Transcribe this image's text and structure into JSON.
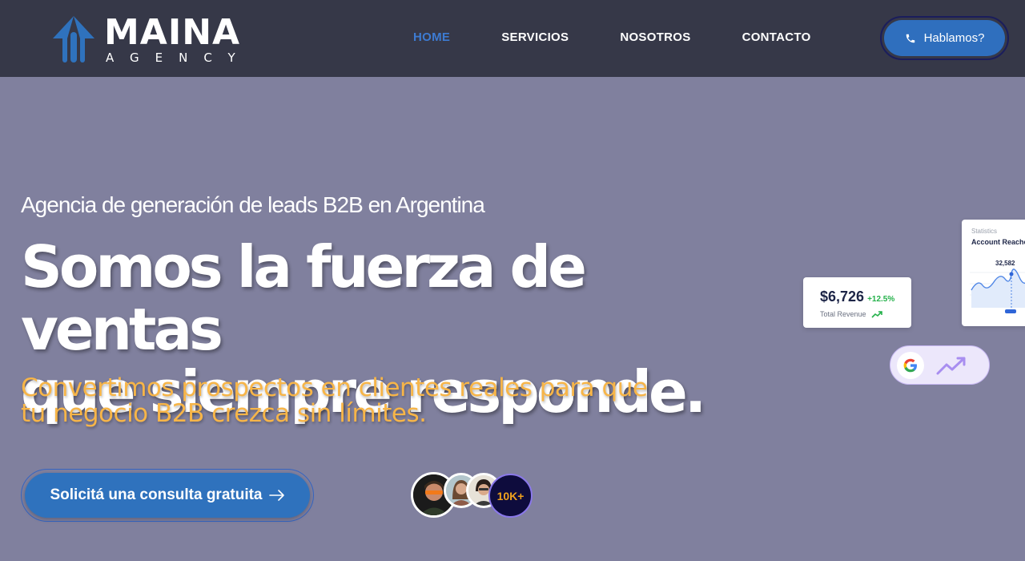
{
  "brand": {
    "name": "MAINA",
    "subtitle": "AGENCY",
    "accent": "#2f72bd"
  },
  "nav": {
    "items": [
      {
        "label": "HOME",
        "active": true
      },
      {
        "label": "SERVICIOS",
        "active": false
      },
      {
        "label": "NOSOTROS",
        "active": false
      },
      {
        "label": "CONTACTO",
        "active": false
      }
    ],
    "call_label": "Hablamos?",
    "call_icon": "phone-icon"
  },
  "hero": {
    "kicker": "Agencia de generación de leads B2B en Argentina",
    "headline_line1": "Somos la fuerza de ventas",
    "headline_line2": "que siempre responde.",
    "subhead_line1": "Convertimos prospectos en clientes reales para que",
    "subhead_line2": "tu negocio B2B crezca sin límites.",
    "cta_label": "Solicitá una consulta gratuita",
    "social_proof_count": "10K+",
    "headline_color": "#ffffff",
    "subhead_color": "#f7b548"
  },
  "widgets": {
    "revenue_value": "$6,726",
    "revenue_change": "+12.5%",
    "revenue_label": "Total Revenue",
    "stats_title": "Statistics",
    "stats_subtitle": "Account Reached",
    "stats_value": "32,582"
  }
}
